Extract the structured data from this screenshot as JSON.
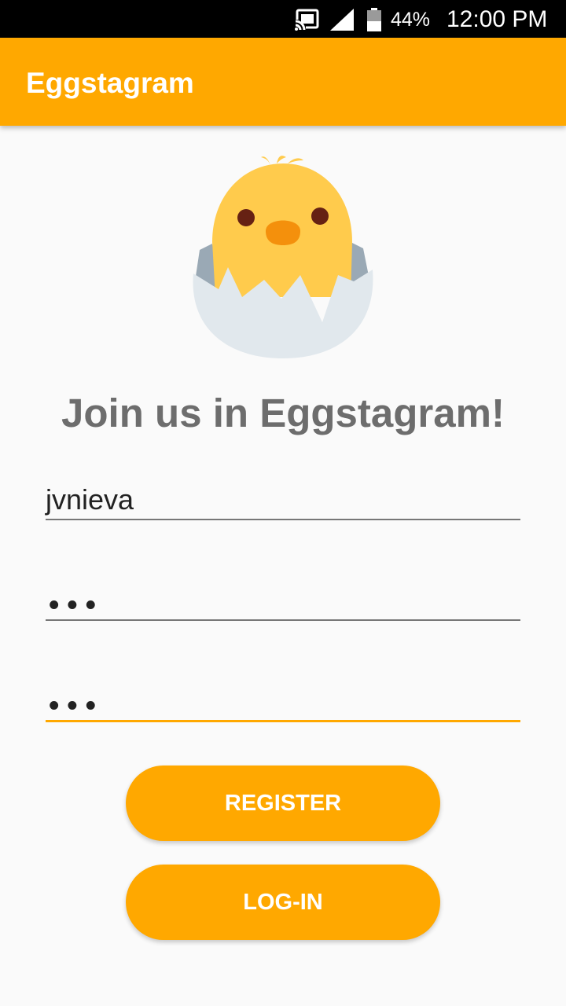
{
  "status_bar": {
    "battery_percent": "44%",
    "time": "12:00 PM",
    "icons": [
      "cast-icon",
      "signal-icon",
      "battery-icon"
    ]
  },
  "app_bar": {
    "title": "Eggstagram",
    "color": "#ffa800"
  },
  "hero": {
    "image": "hatching-chick-icon",
    "headline": "Join us in Eggstagram!"
  },
  "form": {
    "username_value": "jvnieva",
    "password_masked": "•••",
    "confirm_password_masked": "•••"
  },
  "actions": {
    "register_label": "REGISTER",
    "login_label": "LOG-IN"
  }
}
